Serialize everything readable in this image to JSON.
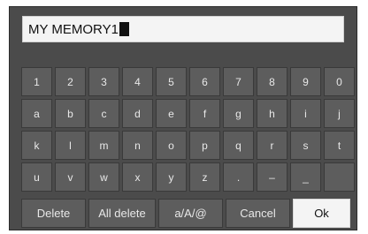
{
  "input": {
    "value": "MY MEMORY1"
  },
  "keys": [
    [
      "1",
      "2",
      "3",
      "4",
      "5",
      "6",
      "7",
      "8",
      "9",
      "0"
    ],
    [
      "a",
      "b",
      "c",
      "d",
      "e",
      "f",
      "g",
      "h",
      "i",
      "j"
    ],
    [
      "k",
      "l",
      "m",
      "n",
      "o",
      "p",
      "q",
      "r",
      "s",
      "t"
    ],
    [
      "u",
      "v",
      "w",
      "x",
      "y",
      "z",
      ".",
      "–",
      "_",
      ""
    ]
  ],
  "actions": {
    "delete": "Delete",
    "all_delete": "All delete",
    "mode": "a/A/@",
    "cancel": "Cancel",
    "ok": "Ok"
  },
  "colors": {
    "panel": "#4b4b4b",
    "key": "#5d5d5d",
    "field": "#f4f4f4",
    "selected": "#f4f4f4"
  }
}
